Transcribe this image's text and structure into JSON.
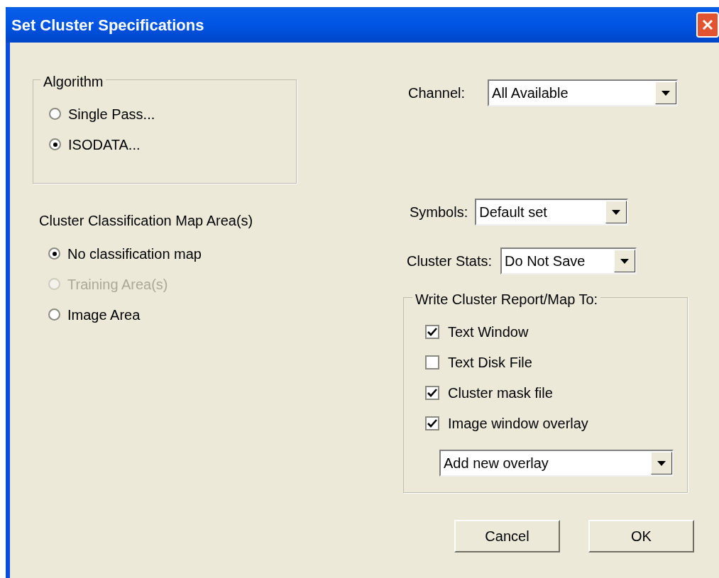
{
  "window": {
    "title": "Set Cluster Specifications"
  },
  "algorithm": {
    "label": "Algorithm",
    "options": [
      {
        "label": "Single Pass...",
        "selected": false
      },
      {
        "label": "ISODATA...",
        "selected": true
      }
    ]
  },
  "classification_map": {
    "label": "Cluster Classification Map Area(s)",
    "options": [
      {
        "label": "No classification map",
        "selected": true,
        "disabled": false
      },
      {
        "label": "Training Area(s)",
        "selected": false,
        "disabled": true
      },
      {
        "label": "Image Area",
        "selected": false,
        "disabled": false
      }
    ]
  },
  "channel": {
    "label": "Channel:",
    "value": "All Available"
  },
  "symbols": {
    "label": "Symbols:",
    "value": "Default set"
  },
  "cluster_stats": {
    "label": "Cluster Stats:",
    "value": "Do Not Save"
  },
  "write_to": {
    "label": "Write Cluster Report/Map To:",
    "options": [
      {
        "label": "Text Window",
        "checked": true
      },
      {
        "label": "Text Disk File",
        "checked": false
      },
      {
        "label": "Cluster mask file",
        "checked": true
      },
      {
        "label": "Image window overlay",
        "checked": true
      }
    ],
    "overlay": {
      "value": "Add new overlay"
    }
  },
  "buttons": [
    {
      "label": "Cancel"
    },
    {
      "label": "OK"
    }
  ]
}
